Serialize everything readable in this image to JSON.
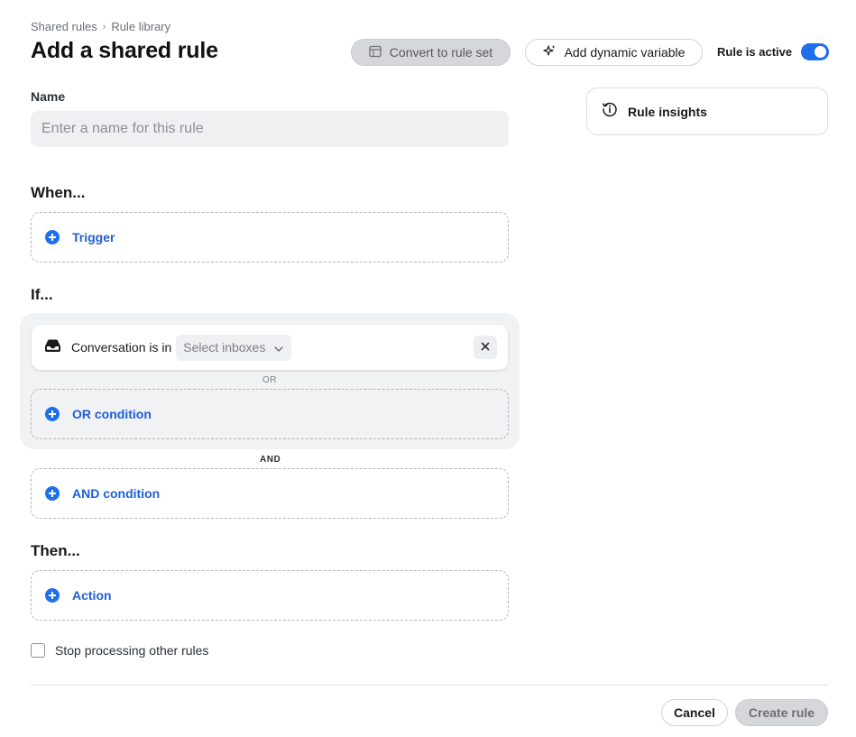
{
  "breadcrumb": {
    "items": [
      "Shared rules",
      "Rule library"
    ],
    "separator": "›"
  },
  "page": {
    "title": "Add a shared rule"
  },
  "header": {
    "convert_label": "Convert to rule set",
    "dynamic_label": "Add dynamic variable",
    "active_label": "Rule is active",
    "active_on": true
  },
  "insights": {
    "label": "Rule insights"
  },
  "name": {
    "label": "Name",
    "placeholder": "Enter a name for this rule",
    "value": ""
  },
  "when": {
    "heading": "When...",
    "trigger_label": "Trigger"
  },
  "if": {
    "heading": "If...",
    "condition": {
      "text": "Conversation is in",
      "select_placeholder": "Select inboxes"
    },
    "or_separator": "OR",
    "or_condition_label": "OR condition",
    "and_separator": "AND",
    "and_condition_label": "AND condition"
  },
  "then": {
    "heading": "Then...",
    "action_label": "Action"
  },
  "options": {
    "stop_processing_label": "Stop processing other rules",
    "stop_processing_checked": false
  },
  "footer": {
    "cancel_label": "Cancel",
    "create_label": "Create rule"
  },
  "colors": {
    "accent": "#1f6feb",
    "link": "#1f5fd6",
    "disabled_bg": "#d5d7da"
  }
}
